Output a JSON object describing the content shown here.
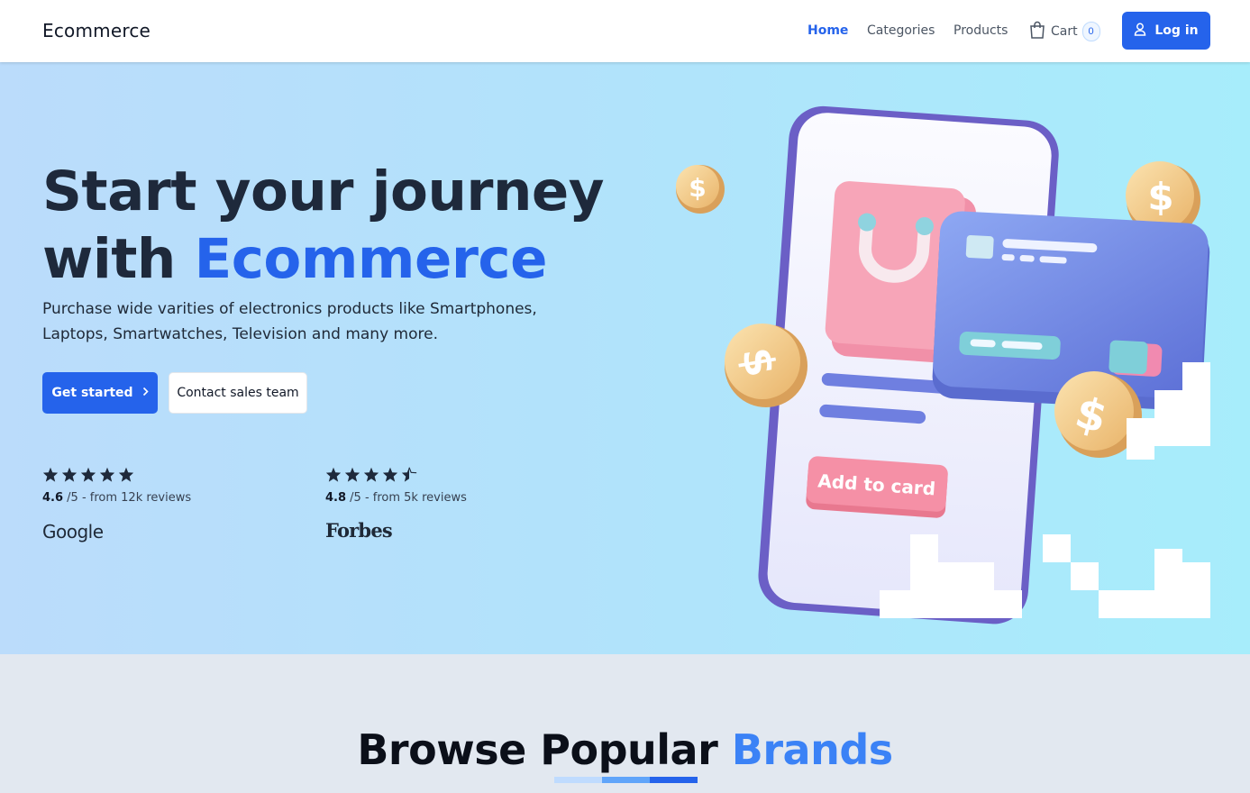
{
  "nav": {
    "brand": "Ecommerce",
    "links": [
      "Home",
      "Categories",
      "Products"
    ],
    "cart_label": "Cart",
    "cart_count": "0",
    "login_label": "Log in"
  },
  "hero": {
    "headline_line1": "Start your journey",
    "headline_with": "with ",
    "headline_accent": "Ecommerce",
    "description": "Purchase wide varities of electronics products like Smartphones, Laptops, Smartwatches, Television and many more.",
    "primary_cta": "Get started",
    "secondary_cta": "Contact sales team",
    "illustration_button": "Add to card"
  },
  "ratings": [
    {
      "stars": 5,
      "score": "4.6",
      "suffix": " /5 - from 12k reviews",
      "source": "Google"
    },
    {
      "stars": 4.5,
      "score": "4.8",
      "suffix": " /5 - from 5k reviews",
      "source": "Forbes"
    }
  ],
  "brands": {
    "title_part1": "Browse Popular ",
    "title_accent": "Brands"
  },
  "colors": {
    "primary": "#2563eb",
    "accent_light": "#3b82f6",
    "hero_start": "#bbdcfb",
    "hero_end": "#a7edfb",
    "section_bg": "#e2e8f0"
  },
  "icons": [
    "shopping-bag-icon",
    "user-icon",
    "chevron-right-icon",
    "star-icon",
    "half-star-icon"
  ]
}
